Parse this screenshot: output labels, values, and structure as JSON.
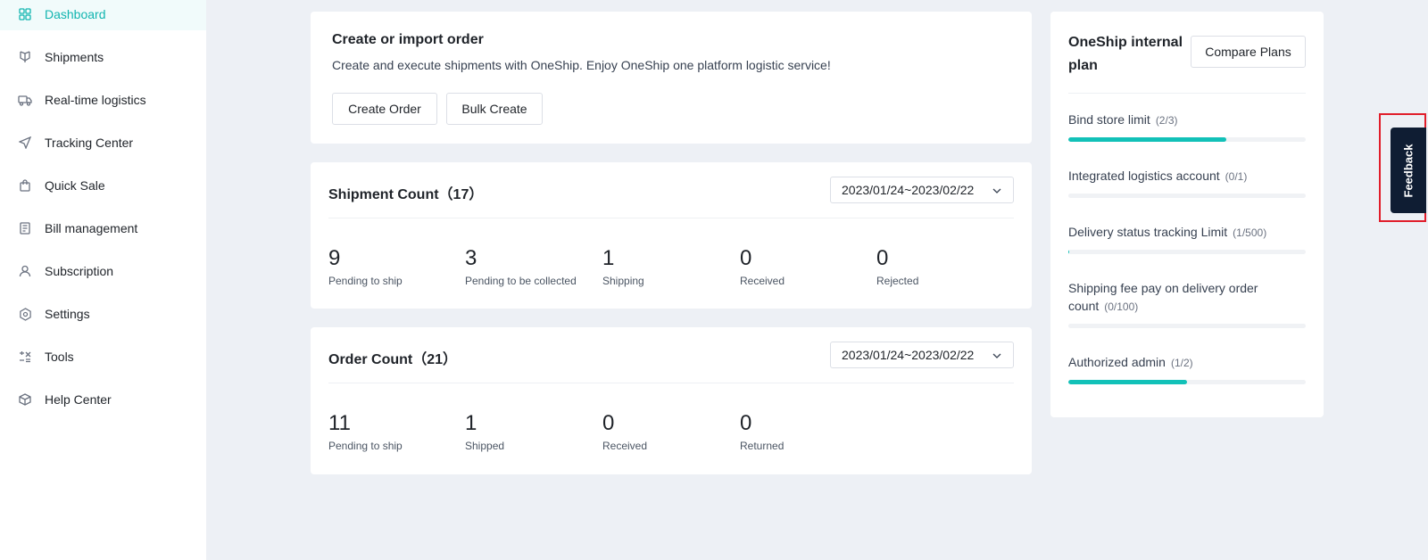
{
  "sidebar": {
    "items": [
      {
        "label": "Dashboard",
        "icon": "grid-icon",
        "active": true
      },
      {
        "label": "Shipments",
        "icon": "shipment-icon"
      },
      {
        "label": "Real-time logistics",
        "icon": "truck-icon"
      },
      {
        "label": "Tracking Center",
        "icon": "navigation-icon"
      },
      {
        "label": "Quick Sale",
        "icon": "shopping-bag-icon"
      },
      {
        "label": "Bill management",
        "icon": "bill-icon"
      },
      {
        "label": "Subscription",
        "icon": "user-icon"
      },
      {
        "label": "Settings",
        "icon": "settings-icon"
      },
      {
        "label": "Tools",
        "icon": "tools-icon"
      },
      {
        "label": "Help Center",
        "icon": "box-icon"
      }
    ]
  },
  "create_order": {
    "title": "Create or import order",
    "description": "Create and execute shipments with OneShip. Enjoy OneShip one platform logistic service!",
    "create_button": "Create Order",
    "bulk_button": "Bulk Create"
  },
  "shipment_count": {
    "title": "Shipment Count（17）",
    "date_range": "2023/01/24~2023/02/22",
    "stats": [
      {
        "value": "9",
        "label": "Pending to ship"
      },
      {
        "value": "3",
        "label": "Pending to be collected"
      },
      {
        "value": "1",
        "label": "Shipping"
      },
      {
        "value": "0",
        "label": "Received"
      },
      {
        "value": "0",
        "label": "Rejected"
      }
    ]
  },
  "order_count": {
    "title": "Order Count（21）",
    "date_range": "2023/01/24~2023/02/22",
    "stats": [
      {
        "value": "11",
        "label": "Pending to ship"
      },
      {
        "value": "1",
        "label": "Shipped"
      },
      {
        "value": "0",
        "label": "Received"
      },
      {
        "value": "0",
        "label": "Returned"
      }
    ]
  },
  "plan": {
    "title": "OneShip internal plan",
    "compare_button": "Compare Plans",
    "limits": [
      {
        "name": "Bind store limit",
        "count": "(2/3)",
        "progress": 0.667
      },
      {
        "name": "Integrated logistics account",
        "count": "(0/1)",
        "progress": 0
      },
      {
        "name": "Delivery status tracking Limit",
        "count": "(1/500)",
        "progress": 0.002
      },
      {
        "name": "Shipping fee pay on delivery order count",
        "count": "(0/100)",
        "progress": 0
      },
      {
        "name": "Authorized admin",
        "count": "(1/2)",
        "progress": 0.5
      }
    ]
  },
  "feedback": {
    "label": "Feedback"
  },
  "colors": {
    "accent": "#12b5b0",
    "progress": "#12c1b8",
    "feedback_bg": "#0f1d33",
    "highlight": "#e11d2a"
  }
}
